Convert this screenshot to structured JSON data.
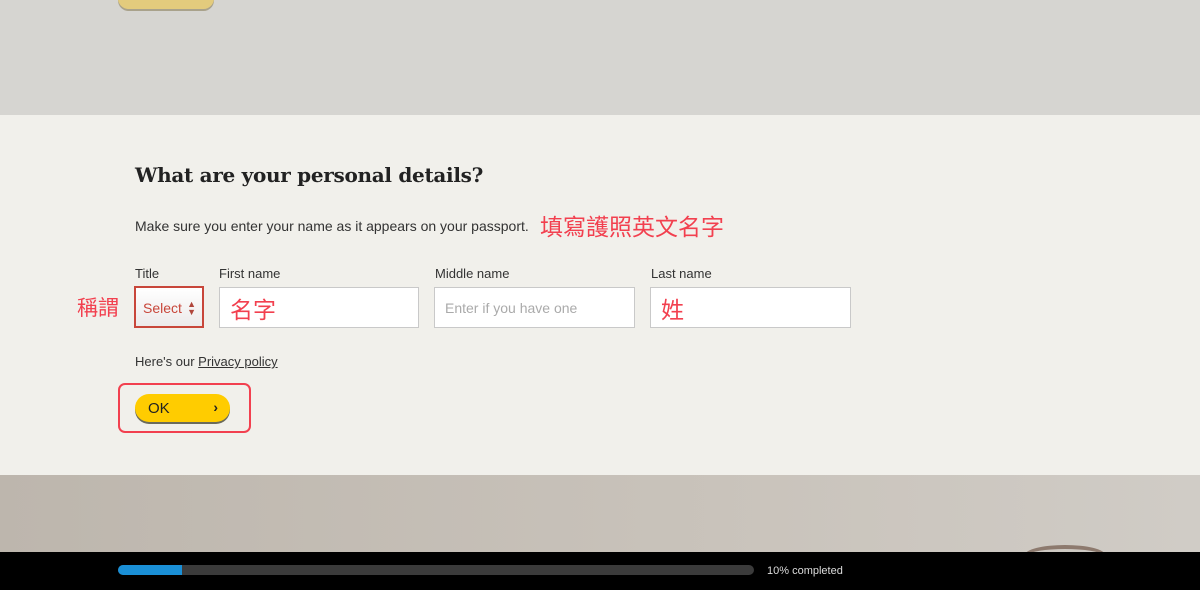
{
  "page": {
    "heading": "What are your personal details?",
    "subtext": "Make sure you enter your name as it appears on your passport."
  },
  "annotations": {
    "passport_note": "填寫護照英文名字",
    "title_note": "稱謂",
    "first_name_note": "名字",
    "last_name_note": "姓"
  },
  "form": {
    "title": {
      "label": "Title",
      "value": "Select"
    },
    "first_name": {
      "label": "First name"
    },
    "middle_name": {
      "label": "Middle name",
      "placeholder": "Enter if you have one"
    },
    "last_name": {
      "label": "Last name"
    }
  },
  "privacy": {
    "prefix": "Here's our ",
    "link": "Privacy policy"
  },
  "ok_button": {
    "label": "OK",
    "icon": "chevron-right-icon"
  },
  "progress": {
    "percent": 10,
    "label": "10% completed",
    "color": "#1a8fd6"
  },
  "colors": {
    "accent": "#ffcc00",
    "annotation": "#f2404f"
  }
}
